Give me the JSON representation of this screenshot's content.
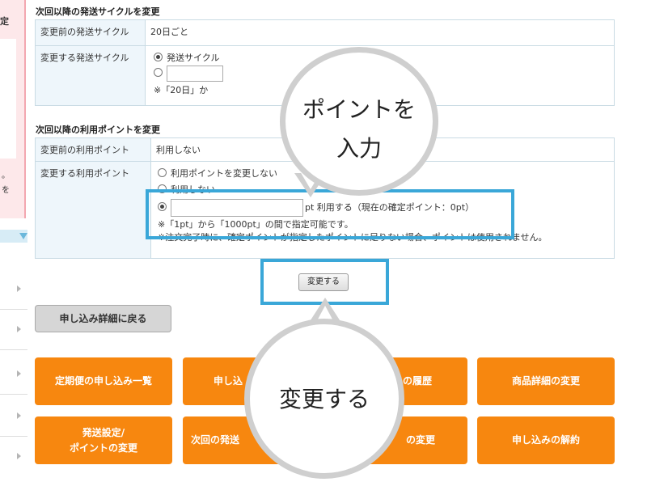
{
  "sidebar": {
    "fragments": [
      "定",
      "。",
      "を"
    ]
  },
  "section1": {
    "title": "次回以降の発送サイクルを変更",
    "rows": [
      {
        "label": "変更前の発送サイクル",
        "value": "20日ごと"
      },
      {
        "label": "変更する発送サイクル",
        "option1": "発送サイクル",
        "note": "※「20日」か"
      }
    ]
  },
  "section2": {
    "title": "次回以降の利用ポイントを変更",
    "rows": [
      {
        "label": "変更前の利用ポイント",
        "value": "利用しない"
      },
      {
        "label": "変更する利用ポイント",
        "option1": "利用ポイントを変更しない",
        "option2": "利用しない",
        "option3_suffix": "pt 利用する（現在の確定ポイント：0pt）",
        "range_note": "※「1pt」から「1000pt」の間で指定可能です。",
        "shortage_note": "※注文完了時に、確定ポイントが指定したポイントに足りない場合、ポイントは使用されません。"
      }
    ]
  },
  "buttons": {
    "change": "変更する",
    "back": "申し込み詳細に戻る"
  },
  "orange_buttons": {
    "row1": [
      "定期便の申し込み一覧",
      "申し込",
      "の履歴",
      "商品詳細の変更"
    ],
    "row2_col1_line1": "発送設定/",
    "row2_col1_line2": "ポイントの変更",
    "row2": [
      "次回の発送",
      "の変更",
      "申し込みの解約"
    ]
  },
  "callouts": {
    "points_line1": "ポイントを",
    "points_line2": "入力",
    "change": "変更する"
  },
  "colors": {
    "highlight": "#3aa7d8",
    "orange": "#f7870f",
    "bubble_border": "#cfcfcf"
  }
}
